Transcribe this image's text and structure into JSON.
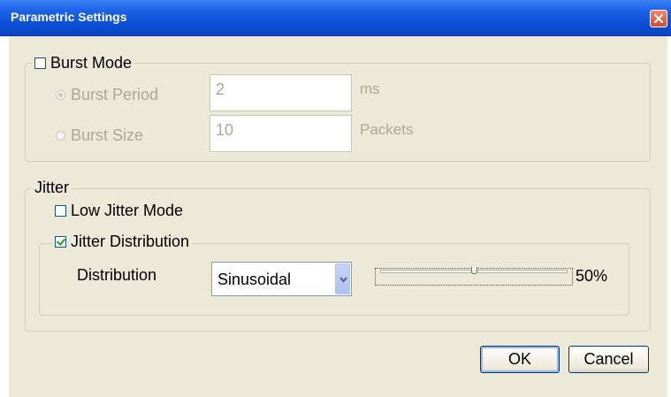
{
  "window": {
    "title": "Parametric Settings"
  },
  "burst": {
    "label": "Burst Mode",
    "checked": false,
    "period_label": "Burst Period",
    "period_value": "2",
    "period_unit": "ms",
    "size_label": "Burst Size",
    "size_value": "10",
    "size_unit": "Packets"
  },
  "jitter": {
    "label": "Jitter",
    "low_jitter_label": "Low Jitter Mode",
    "low_jitter_checked": false,
    "distribution_group_label": "Jitter Distribution",
    "distribution_group_checked": true,
    "distribution_label": "Distribution",
    "distribution_value": "Sinusoidal",
    "slider_value": 50,
    "slider_percent_label": "50%"
  },
  "buttons": {
    "ok": "OK",
    "cancel": "Cancel"
  },
  "icons": {
    "close": "close-icon",
    "dropdown": "chevron-down-icon"
  },
  "colors": {
    "titlebar": "#0b4fd6",
    "client_bg": "#ece9d8",
    "disabled_text": "#aca899",
    "check_green": "#21a121"
  }
}
